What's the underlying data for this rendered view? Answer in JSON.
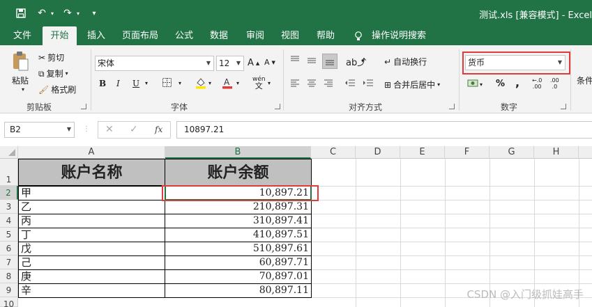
{
  "window": {
    "title": "测试.xls  [兼容模式]  -  Excel"
  },
  "quick_access": {
    "icons": [
      "save-icon",
      "undo-icon",
      "redo-icon",
      "customize-icon"
    ]
  },
  "tabs": [
    "文件",
    "开始",
    "插入",
    "页面布局",
    "公式",
    "数据",
    "审阅",
    "视图",
    "帮助",
    "操作说明搜索"
  ],
  "ribbon": {
    "clipboard": {
      "paste": "粘贴",
      "cut": "剪切",
      "copy": "复制",
      "format_painter": "格式刷",
      "label": "剪贴板"
    },
    "font": {
      "name": "宋体",
      "size": "12",
      "bold": "B",
      "italic": "I",
      "underline": "U",
      "label": "字体",
      "phonetic": "wén"
    },
    "alignment": {
      "wrap": "自动换行",
      "merge": "合并后居中",
      "label": "对齐方式"
    },
    "number": {
      "format": "货币",
      "percent": "%",
      "comma": ",",
      "inc_decimal": ".00",
      "dec_decimal": ".0",
      "label": "数字"
    },
    "styles": {
      "conditional": "条件"
    }
  },
  "formula_bar": {
    "name_box": "B2",
    "fx": "fx",
    "value": "10897.21"
  },
  "sheet": {
    "columns": [
      "A",
      "B",
      "C",
      "D",
      "E",
      "F",
      "G",
      "H"
    ],
    "rows": [
      "1",
      "2",
      "3",
      "4",
      "5",
      "6",
      "7",
      "8",
      "9",
      "10"
    ],
    "header": [
      "账户名称",
      "账户余额"
    ],
    "data": [
      [
        "甲",
        "10,897.21"
      ],
      [
        "乙",
        "210,897.31"
      ],
      [
        "丙",
        "310,897.41"
      ],
      [
        "丁",
        "410,897.51"
      ],
      [
        "戊",
        "510,897.61"
      ],
      [
        "己",
        "60,897.71"
      ],
      [
        "庚",
        "70,897.01"
      ],
      [
        "辛",
        "80,897.11"
      ]
    ]
  },
  "watermark": "CSDN @入门级抓娃高手",
  "colors": {
    "accent": "#217346",
    "highlight": "#e03b3b",
    "header_fill": "#c0c0c0",
    "underline_red": "#e03b3b",
    "highlighter_yellow": "#ffe600"
  }
}
